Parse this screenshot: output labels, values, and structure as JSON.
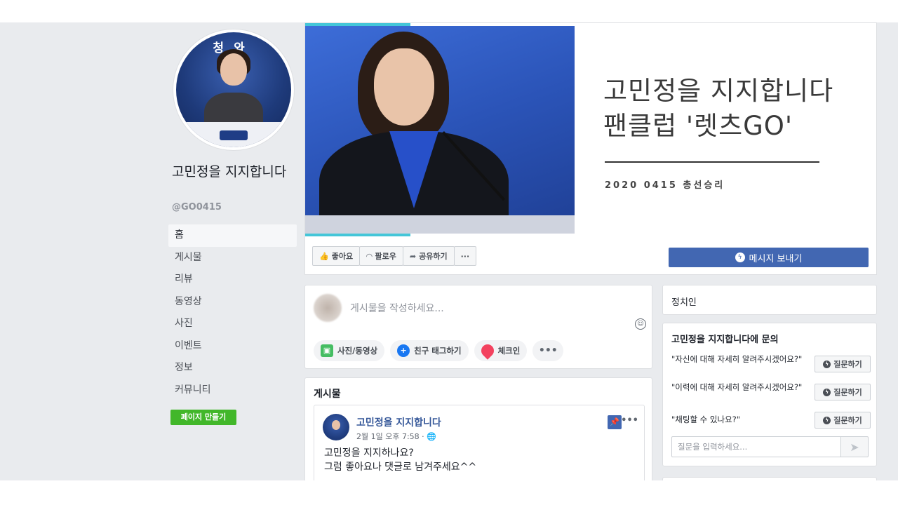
{
  "page": {
    "title": "고민정을 지지합니다",
    "handle": "@GO0415",
    "profile_sign": "청와"
  },
  "nav": {
    "items": [
      "홈",
      "게시물",
      "리뷰",
      "동영상",
      "사진",
      "이벤트",
      "정보",
      "커뮤니티"
    ],
    "active": "홈",
    "create_page_label": "페이지 만들기"
  },
  "cover": {
    "headline_line1": "고민정을 지지합니다",
    "headline_line2": "팬클럽 '렛츠GO'",
    "subtitle": "2020 0415 총선승리"
  },
  "actions": {
    "like_label": "좋아요",
    "follow_label": "팔로우",
    "share_label": "공유하기",
    "more_label": "···",
    "message_label": "메시지 보내기"
  },
  "composer": {
    "placeholder": "게시물을 작성하세요...",
    "photo_label": "사진/동영상",
    "tag_label": "친구 태그하기",
    "checkin_label": "체크인",
    "more_label": "•••"
  },
  "posts": {
    "heading": "게시물",
    "items": [
      {
        "author": "고민정을 지지합니다",
        "time": "2월 1일 오후 7:58 · ",
        "text_line1": "고민정을 지지하나요?",
        "text_line2": "그럼 좋아요나 댓글로 남겨주세요^^",
        "more": "•••"
      }
    ]
  },
  "sidebar_right": {
    "category": "정치인",
    "inquiry_title": "고민정을 지지합니다에 문의",
    "questions": [
      "\"자신에 대해 자세히 알려주시겠어요?\"",
      "\"이력에 대해 자세히 알려주시겠어요?\"",
      "\"채팅할 수 있나요?\""
    ],
    "ask_label": "질문하기",
    "input_placeholder": "질문을 입력하세요..."
  },
  "colors": {
    "fb_blue": "#4267b2",
    "link_blue": "#365899",
    "green": "#42b72a",
    "background": "#e9ebee",
    "cover_accent": "#44c6d8"
  }
}
